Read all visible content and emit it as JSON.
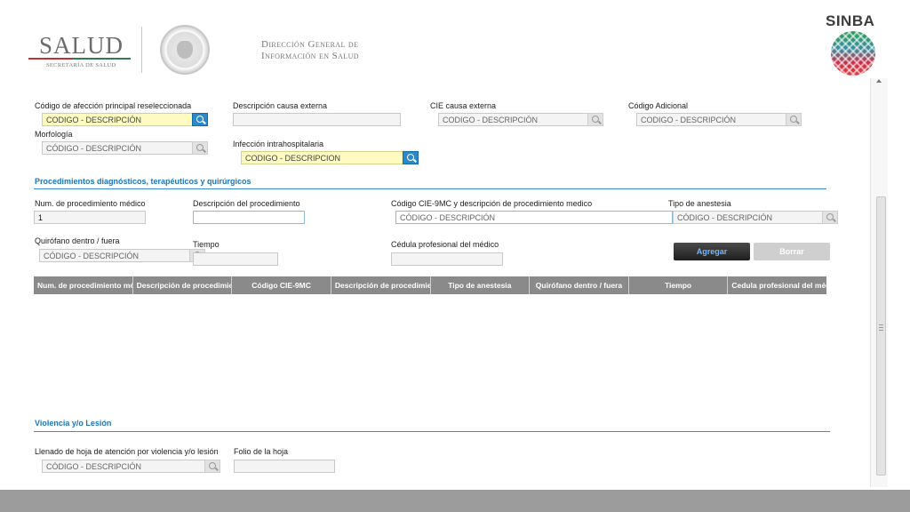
{
  "header": {
    "salud_logo": "SALUD",
    "salud_subtitle": "SECRETARÍA DE SALUD",
    "dgis_line1": "Dirección General de",
    "dgis_line2": "Información en Salud",
    "sinba_logo": "SINBA"
  },
  "form_top": {
    "codigo_afeccion_label": "Código de afección principal reseleccionada",
    "codigo_afeccion_placeholder": "CODIGO - DESCRIPCIÓN",
    "descripcion_causa_label": "Descripción causa externa",
    "descripcion_causa_value": "",
    "cie_causa_label": "CIE causa externa",
    "cie_causa_placeholder": "CODIGO - DESCRIPCIÓN",
    "codigo_adicional_label": "Código Adicional",
    "codigo_adicional_placeholder": "CODIGO - DESCRIPCIÓN",
    "morfologia_label": "Morfología",
    "morfologia_placeholder": "CÓDIGO - DESCRIPCIÓN",
    "infeccion_label": "Infección intrahospitalaria",
    "infeccion_placeholder": "CODIGO - DESCRIPCION"
  },
  "procedimientos": {
    "section_title": "Procedimientos diagnósticos, terapéuticos y quirúrgicos",
    "num_label": "Num. de procedimiento médico",
    "num_value": "1",
    "descripcion_label": "Descripción del procedimiento",
    "descripcion_value": "",
    "codigo_cie9_label": "Código CIE-9MC y descripción de procedimiento medico",
    "codigo_cie9_placeholder": "CÓDIGO - DESCRIPCIÓN",
    "tipo_anestesia_label": "Tipo de anestesia",
    "tipo_anestesia_placeholder": "CÓDIGO - DESCRIPCIÓN",
    "quirofano_label": "Quirófano dentro / fuera",
    "quirofano_placeholder": "CÓDIGO - DESCRIPCIÓN",
    "tiempo_label": "Tiempo",
    "tiempo_value": "",
    "cedula_label": "Cédula profesional del médico",
    "cedula_value": "",
    "agregar_label": "Agregar",
    "borrar_label": "Borrar",
    "table_headers": [
      "Num. de procedimiento médico",
      "Descripción de procedimiento",
      "Código CIE-9MC",
      "Descripción de procedimiento",
      "Tipo de anestesia",
      "Quirófano dentro / fuera",
      "Tiempo",
      "Cedula profesional del médico"
    ]
  },
  "violencia": {
    "section_title": "Violencia y/o Lesión",
    "llenado_label": "Llenado de hoja de atención por violencia y/o lesión",
    "llenado_placeholder": "CÓDIGO - DESCRIPCIÓN",
    "folio_label": "Folio de la hoja",
    "folio_value": ""
  },
  "colors": {
    "section_blue": "#1e74b5",
    "highlight_yellow": "#fdfbc2",
    "search_blue": "#2d88c9",
    "table_header_gray": "#8a8a8a"
  },
  "icons": {
    "search": "search-icon"
  }
}
